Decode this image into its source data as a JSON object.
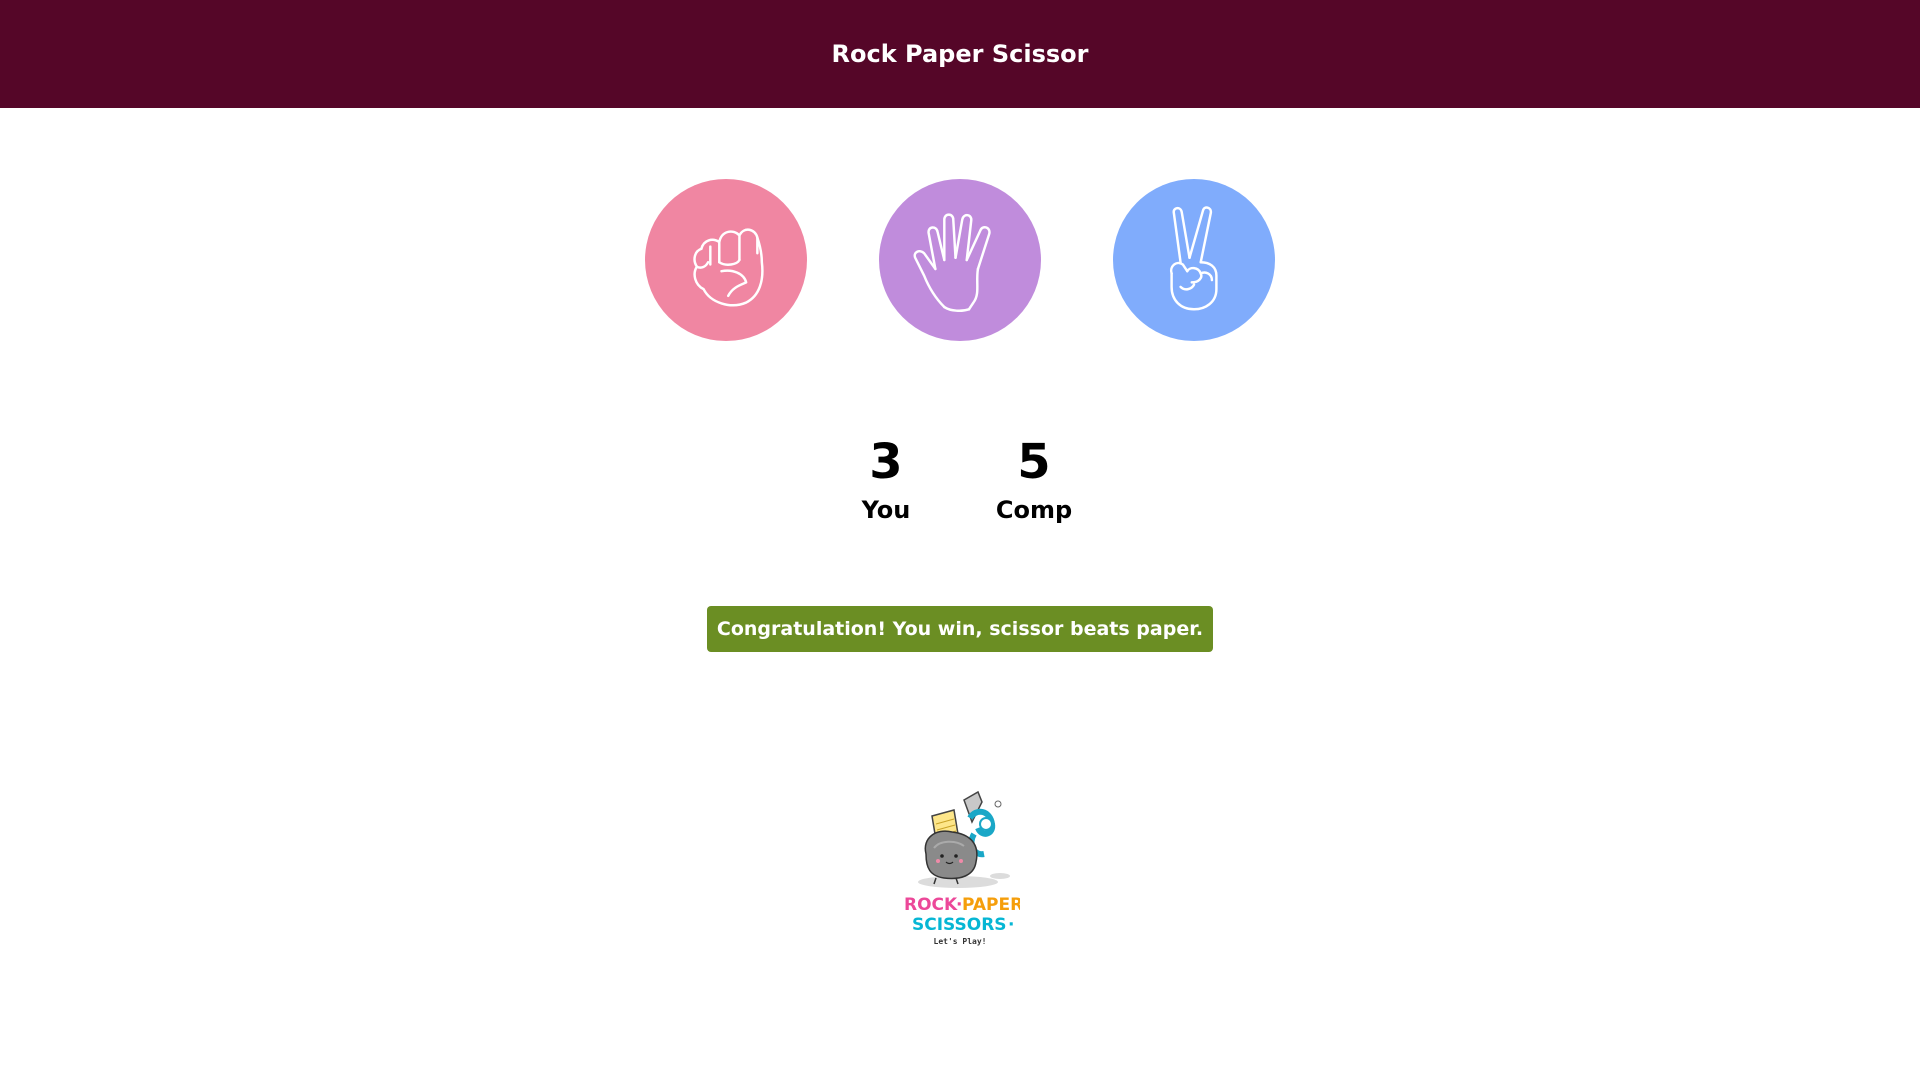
{
  "header": {
    "title": "Rock Paper Scissor"
  },
  "choices": [
    {
      "name": "rock",
      "icon": "fist-icon",
      "color": "#f086a2"
    },
    {
      "name": "paper",
      "icon": "open-hand-icon",
      "color": "#c08cdc"
    },
    {
      "name": "scissor",
      "icon": "peace-hand-icon",
      "color": "#80acfc"
    }
  ],
  "scoreboard": {
    "user_score": "3",
    "user_label": "You",
    "comp_score": "5",
    "comp_label": "Comp"
  },
  "result": {
    "message": "Congratulation! You win, scissor beats paper.",
    "color": "#6b8e23"
  },
  "logo": {
    "line1_a": "ROCK",
    "line1_b": "PAPER",
    "line2": "SCISSORS",
    "tagline": "Let's Play!"
  },
  "colors": {
    "header_bg": "#550628",
    "rock": "#f086a2",
    "paper": "#c08cdc",
    "scissor": "#80acfc"
  }
}
